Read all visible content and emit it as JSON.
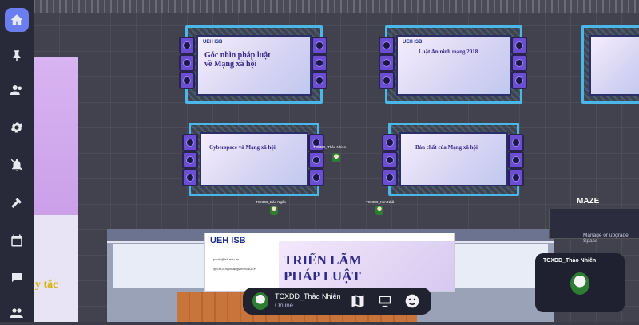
{
  "sidebar": {
    "items": [
      {
        "icon": "home-icon",
        "active": true
      },
      {
        "icon": "pin-icon"
      },
      {
        "icon": "people-icon"
      },
      {
        "icon": "gear-icon"
      },
      {
        "icon": "mute-icon"
      },
      {
        "icon": "hammer-icon"
      },
      {
        "icon": "calendar-icon"
      },
      {
        "icon": "chat-icon"
      },
      {
        "icon": "participants-icon"
      }
    ]
  },
  "stages": [
    {
      "title": "Góc nhìn pháp luật\nvề Mạng xã hội",
      "logo": "UEH ISB"
    },
    {
      "title": "Luật An ninh mạng 2018",
      "logo": "UEH ISB"
    },
    {
      "title": "Cyberspace và Mạng xã hội",
      "logo": "UEH ISB"
    },
    {
      "title": "Bản chất của Mạng xã hội",
      "logo": "UEH ISB"
    }
  ],
  "players": [
    {
      "label": "TCXDĐ_Thảo Nhiên"
    },
    {
      "label": "TCXDĐ_Bảo Ngân"
    },
    {
      "label": "TCXDĐ_Kim Nhã"
    }
  ],
  "exhibition_banner": {
    "logo": "UEH ISB",
    "title_line1": "TRIỂN LÃM",
    "title_line2": "PHÁP LUẬT",
    "contact_email": "youth@isb.edu.vn",
    "contact_facebook": "@SFLE.ngoisangvienISBUEH"
  },
  "left_banner": {
    "text_fragment": "y tắc"
  },
  "maze": {
    "label": "MAZE",
    "hint": "Manage or upgrade Space"
  },
  "user_card": {
    "name": "TCXDĐ_Thảo Nhiên"
  },
  "bottom_bar": {
    "name": "TCXDĐ_Thảo Nhiên",
    "status": "Online",
    "icons": [
      "map-icon",
      "screen-share-icon",
      "emoji-icon"
    ]
  },
  "colors": {
    "sidebar_bg": "#282a3a",
    "accent": "#6b7ef0",
    "truss": "#4bb6e8"
  }
}
